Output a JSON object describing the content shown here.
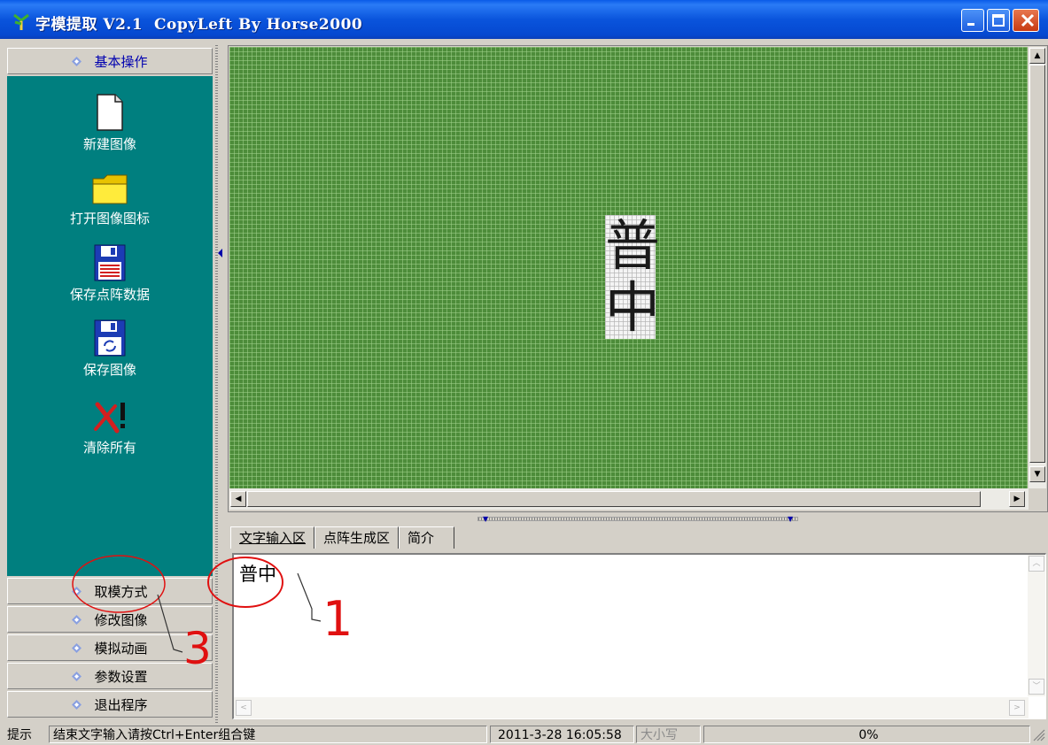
{
  "window": {
    "title": "字模提取 V2.1  CopyLeft By Horse2000"
  },
  "sidebar": {
    "active_group": "基本操作",
    "tools": [
      {
        "label": "新建图像",
        "icon": "new-document-icon"
      },
      {
        "label": "打开图像图标",
        "icon": "open-folder-icon"
      },
      {
        "label": "保存点阵数据",
        "icon": "save-matrix-data-icon"
      },
      {
        "label": "保存图像",
        "icon": "save-image-icon"
      },
      {
        "label": "清除所有",
        "icon": "clear-all-icon"
      }
    ],
    "groups": [
      "取模方式",
      "修改图像",
      "模拟动画",
      "参数设置",
      "退出程序"
    ]
  },
  "canvas": {
    "characters": [
      "普",
      "中"
    ]
  },
  "tabs": [
    {
      "label": "文字输入区",
      "active": true
    },
    {
      "label": "点阵生成区",
      "active": false
    },
    {
      "label": "简介",
      "active": false
    }
  ],
  "input": {
    "text": "普中"
  },
  "statusbar": {
    "label": "提示",
    "hint": "结束文字输入请按Ctrl+Enter组合键",
    "datetime": "2011-3-28 16:05:58",
    "caps": "大小写",
    "progress_text": "0%"
  },
  "annotations": {
    "marker_1": "1",
    "marker_3": "3"
  },
  "colors": {
    "sidebar_bg": "#007f7f",
    "canvas_bg": "#4d8c3a",
    "annotation": "#e01010"
  }
}
